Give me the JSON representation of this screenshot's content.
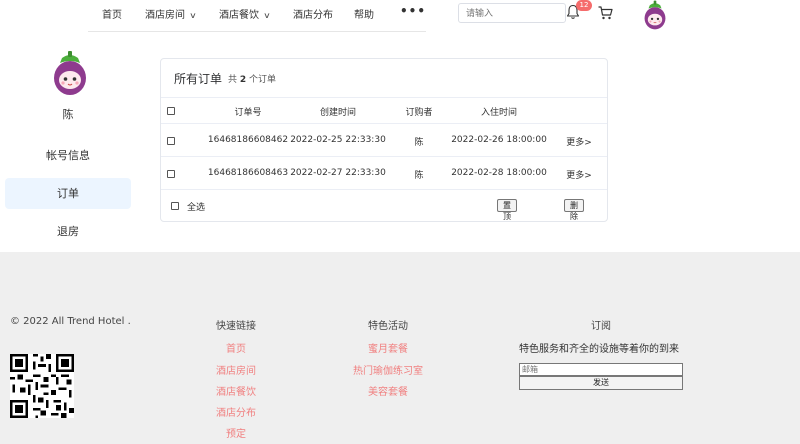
{
  "nav": {
    "items": [
      {
        "label": "首页",
        "dropdown": false
      },
      {
        "label": "酒店房间",
        "dropdown": true
      },
      {
        "label": "酒店餐饮",
        "dropdown": true
      },
      {
        "label": "酒店分布",
        "dropdown": false
      },
      {
        "label": "帮助",
        "dropdown": false
      }
    ],
    "more_label": "•••",
    "search_placeholder": "请输入",
    "notification_count": "12",
    "icons": [
      "bell-icon",
      "cart-icon",
      "eggplant-avatar-icon"
    ]
  },
  "sidebar": {
    "user_name": "陈",
    "items": [
      {
        "label": "帐号信息",
        "active": false
      },
      {
        "label": "订单",
        "active": true
      },
      {
        "label": "退房",
        "active": false
      }
    ]
  },
  "orders": {
    "title": "所有订单",
    "count_prefix": "共",
    "count": "2",
    "count_suffix": "个订单",
    "columns": [
      "订单号",
      "创建时间",
      "订购者",
      "入住时间"
    ],
    "rows": [
      {
        "order_no": "16468186608462",
        "created": "2022-02-25 22:33:30",
        "buyer": "陈",
        "checkin": "2022-02-26 18:00:00",
        "more": "更多>"
      },
      {
        "order_no": "16468186608463",
        "created": "2022-02-27 22:33:30",
        "buyer": "陈",
        "checkin": "2022-02-28 18:00:00",
        "more": "更多>"
      }
    ],
    "select_all": "全选",
    "pin_label": "置顶",
    "delete_label": "删除"
  },
  "footer": {
    "copyright": "© 2022 All Trend Hotel .",
    "quick_links": {
      "title": "快速链接",
      "links": [
        "首页",
        "酒店房间",
        "酒店餐饮",
        "酒店分布",
        "预定"
      ]
    },
    "activities": {
      "title": "特色活动",
      "links": [
        "蜜月套餐",
        "热门瑜伽练习室",
        "美容套餐"
      ]
    },
    "subscribe": {
      "title": "订阅",
      "text": "特色服务和齐全的设施等着你的到来",
      "email_placeholder": "邮箱",
      "send_label": "发送"
    }
  },
  "colors": {
    "accent_link": "#f08080",
    "active_bg": "#ecf5ff",
    "badge": "#f56c6c",
    "footer_bg": "#efefef"
  }
}
